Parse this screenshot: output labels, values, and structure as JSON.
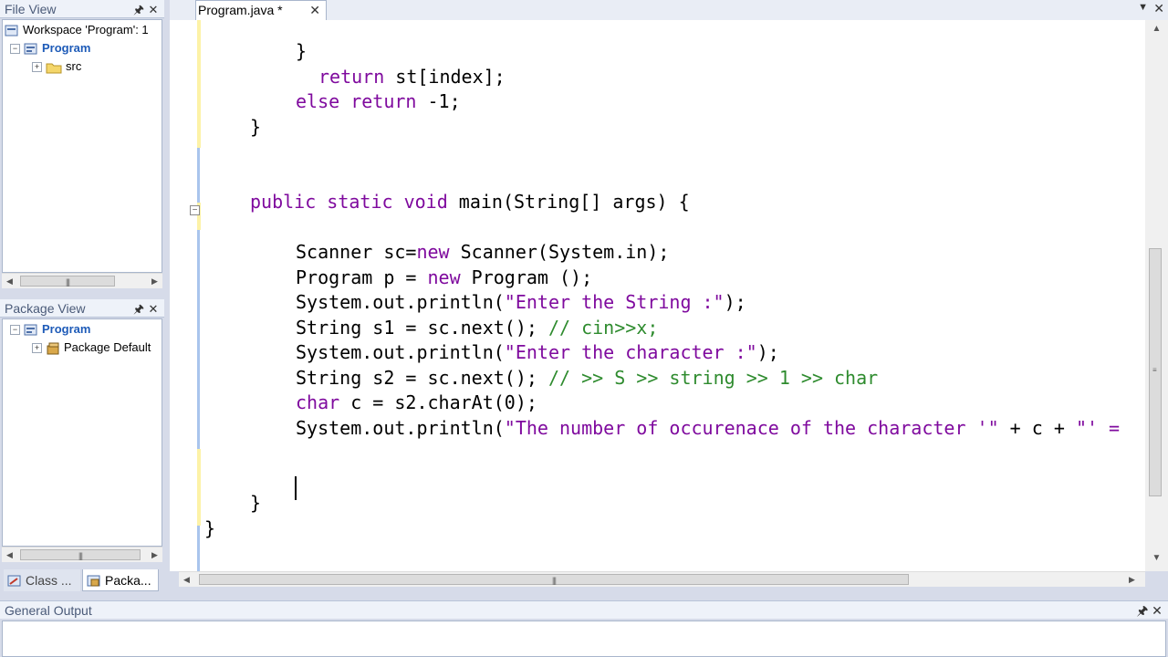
{
  "file_view": {
    "title": "File View",
    "workspace_label": "Workspace 'Program': 1",
    "project": "Program",
    "folder": "src"
  },
  "package_view": {
    "title": "Package View",
    "project": "Program",
    "package": "Package Default"
  },
  "bottom_tabs": [
    {
      "label": "Class ..."
    },
    {
      "label": "Packa..."
    }
  ],
  "editor": {
    "tab_label": "Program.java *",
    "code_lines": [
      {
        "indent": 4,
        "parts": [
          {
            "t": "}",
            "c": "cls"
          }
        ]
      },
      {
        "indent": 6,
        "parts": [
          {
            "t": "return",
            "c": "kw"
          },
          {
            "t": " st[index];",
            "c": "cls"
          }
        ]
      },
      {
        "indent": 4,
        "parts": [
          {
            "t": "else",
            "c": "kw"
          },
          {
            "t": " ",
            "c": "cls"
          },
          {
            "t": "return",
            "c": "kw"
          },
          {
            "t": " -1;",
            "c": "cls"
          }
        ]
      },
      {
        "indent": 0,
        "parts": [
          {
            "t": "}",
            "c": "cls"
          }
        ]
      },
      {
        "indent": 0,
        "parts": []
      },
      {
        "indent": 0,
        "parts": []
      },
      {
        "indent": 0,
        "parts": [
          {
            "t": "public static void",
            "c": "kw"
          },
          {
            "t": " main(String[] args) {",
            "c": "cls"
          }
        ]
      },
      {
        "indent": 0,
        "parts": []
      },
      {
        "indent": 4,
        "parts": [
          {
            "t": "Scanner sc=",
            "c": "cls"
          },
          {
            "t": "new",
            "c": "kw"
          },
          {
            "t": " Scanner(System.in);",
            "c": "cls"
          }
        ]
      },
      {
        "indent": 4,
        "parts": [
          {
            "t": "Program p = ",
            "c": "cls"
          },
          {
            "t": "new",
            "c": "kw"
          },
          {
            "t": " Program ();",
            "c": "cls"
          }
        ]
      },
      {
        "indent": 4,
        "parts": [
          {
            "t": "System.out.println(",
            "c": "cls"
          },
          {
            "t": "\"Enter the String :\"",
            "c": "str"
          },
          {
            "t": ");",
            "c": "cls"
          }
        ]
      },
      {
        "indent": 4,
        "parts": [
          {
            "t": "String s1 = sc.next(); ",
            "c": "cls"
          },
          {
            "t": "// cin>>x;",
            "c": "cm"
          }
        ]
      },
      {
        "indent": 4,
        "parts": [
          {
            "t": "System.out.println(",
            "c": "cls"
          },
          {
            "t": "\"Enter the character :\"",
            "c": "str"
          },
          {
            "t": ");",
            "c": "cls"
          }
        ]
      },
      {
        "indent": 4,
        "parts": [
          {
            "t": "String s2 = sc.next(); ",
            "c": "cls"
          },
          {
            "t": "// >> S >> string >> 1 >> char",
            "c": "cm"
          }
        ]
      },
      {
        "indent": 4,
        "parts": [
          {
            "t": "char",
            "c": "kw"
          },
          {
            "t": " c = s2.charAt(0);",
            "c": "cls"
          }
        ]
      },
      {
        "indent": 4,
        "parts": [
          {
            "t": "System.out.println(",
            "c": "cls"
          },
          {
            "t": "\"The number of occurenace of the character '\"",
            "c": "str"
          },
          {
            "t": " + c + ",
            "c": "cls"
          },
          {
            "t": "\"' =",
            "c": "str"
          }
        ]
      },
      {
        "indent": 0,
        "parts": []
      },
      {
        "indent": 0,
        "parts": []
      },
      {
        "indent": 0,
        "parts": [
          {
            "t": "}",
            "c": "cls"
          }
        ]
      },
      {
        "indent": -4,
        "parts": [
          {
            "t": "}",
            "c": "cls"
          }
        ]
      }
    ]
  },
  "output": {
    "title": "General Output"
  },
  "icons": {
    "pin": "pin-icon",
    "close": "close-icon"
  }
}
